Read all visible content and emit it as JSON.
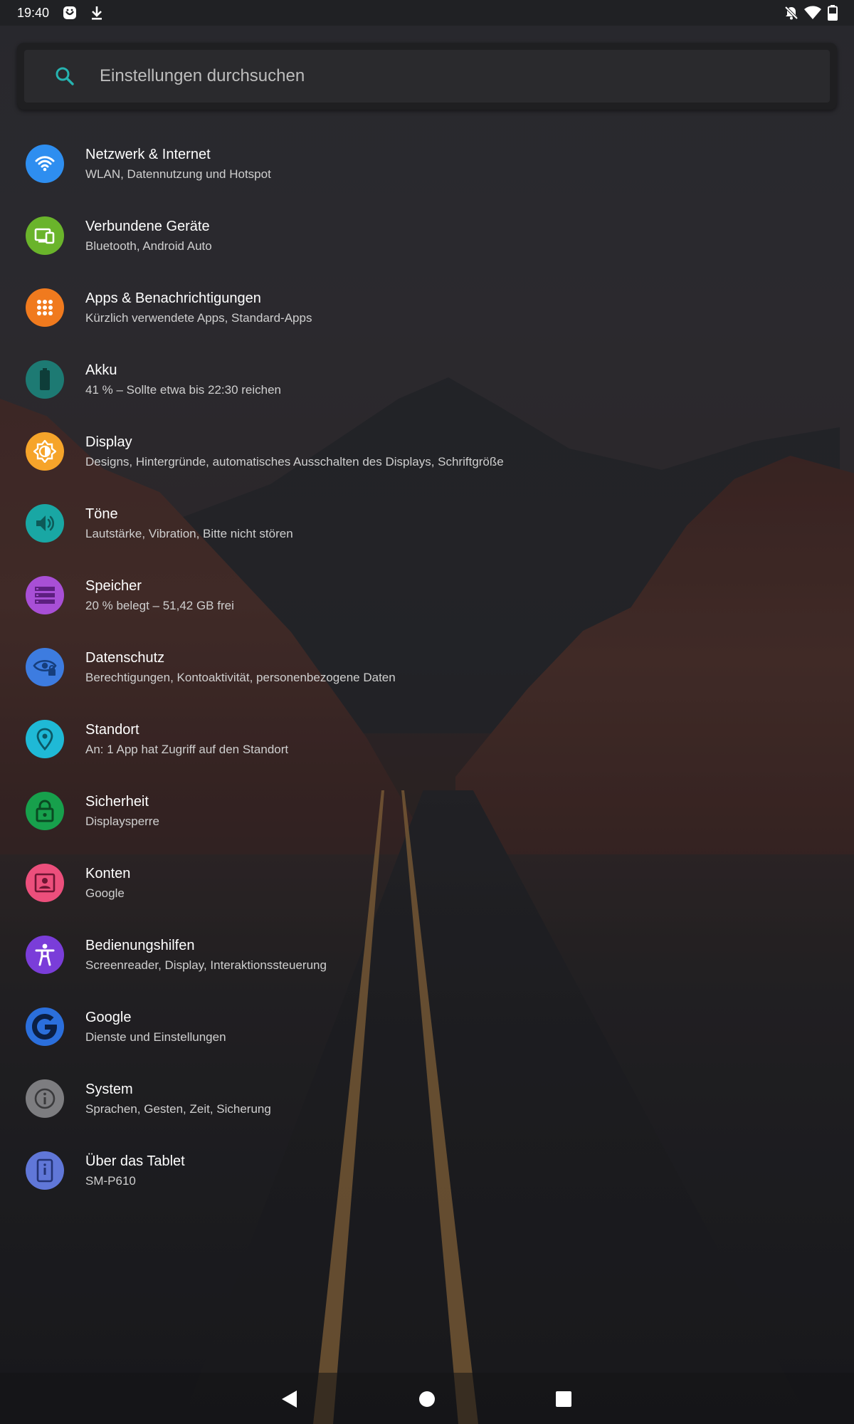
{
  "status_bar": {
    "time": "19:40",
    "icons": [
      "notification-app-icon",
      "download-icon",
      "do-not-disturb-off-icon",
      "wifi-icon",
      "battery-icon"
    ]
  },
  "search": {
    "placeholder": "Einstellungen durchsuchen"
  },
  "settings": {
    "items": [
      {
        "title": "Netzwerk & Internet",
        "summary": "WLAN, Datennutzung und Hotspot",
        "icon": "wifi-icon",
        "color": "#2e8ef0"
      },
      {
        "title": "Verbundene Geräte",
        "summary": "Bluetooth, Android Auto",
        "icon": "connected-devices-icon",
        "color": "#6ab42b"
      },
      {
        "title": "Apps & Benachrichtigungen",
        "summary": "Kürzlich verwendete Apps, Standard-Apps",
        "icon": "apps-grid-icon",
        "color": "#f07a1e"
      },
      {
        "title": "Akku",
        "summary": "41 % – Sollte etwa bis 22:30 reichen",
        "icon": "battery-icon",
        "color": "#1d7a73"
      },
      {
        "title": "Display",
        "summary": "Designs, Hintergründe, automatisches Ausschalten des Displays, Schriftgröße",
        "icon": "brightness-icon",
        "color": "#f6a42a"
      },
      {
        "title": "Töne",
        "summary": "Lautstärke, Vibration, Bitte nicht stören",
        "icon": "volume-icon",
        "color": "#19a7a4"
      },
      {
        "title": "Speicher",
        "summary": "20 % belegt – 51,42 GB frei",
        "icon": "storage-icon",
        "color": "#a84fd6"
      },
      {
        "title": "Datenschutz",
        "summary": "Berechtigungen, Kontoaktivität, personenbezogene Daten",
        "icon": "privacy-eye-icon",
        "color": "#3d7ce0"
      },
      {
        "title": "Standort",
        "summary": "An: 1 App hat Zugriff auf den Standort",
        "icon": "location-pin-icon",
        "color": "#1fb9d6"
      },
      {
        "title": "Sicherheit",
        "summary": "Displaysperre",
        "icon": "lock-icon",
        "color": "#17a04c"
      },
      {
        "title": "Konten",
        "summary": "Google",
        "icon": "account-icon",
        "color": "#ec4f7c"
      },
      {
        "title": "Bedienungshilfen",
        "summary": "Screenreader, Display, Interaktionssteuerung",
        "icon": "accessibility-icon",
        "color": "#7a3dd9"
      },
      {
        "title": "Google",
        "summary": "Dienste und Einstellungen",
        "icon": "google-g-icon",
        "color": "#2b6fdc"
      },
      {
        "title": "System",
        "summary": "Sprachen, Gesten, Zeit, Sicherung",
        "icon": "info-icon",
        "color": "#7d7d80"
      },
      {
        "title": "Über das Tablet",
        "summary": "SM-P610",
        "icon": "tablet-icon",
        "color": "#6077d8"
      }
    ]
  },
  "nav_bar": {
    "buttons": [
      "back-icon",
      "home-icon",
      "recents-icon"
    ]
  }
}
